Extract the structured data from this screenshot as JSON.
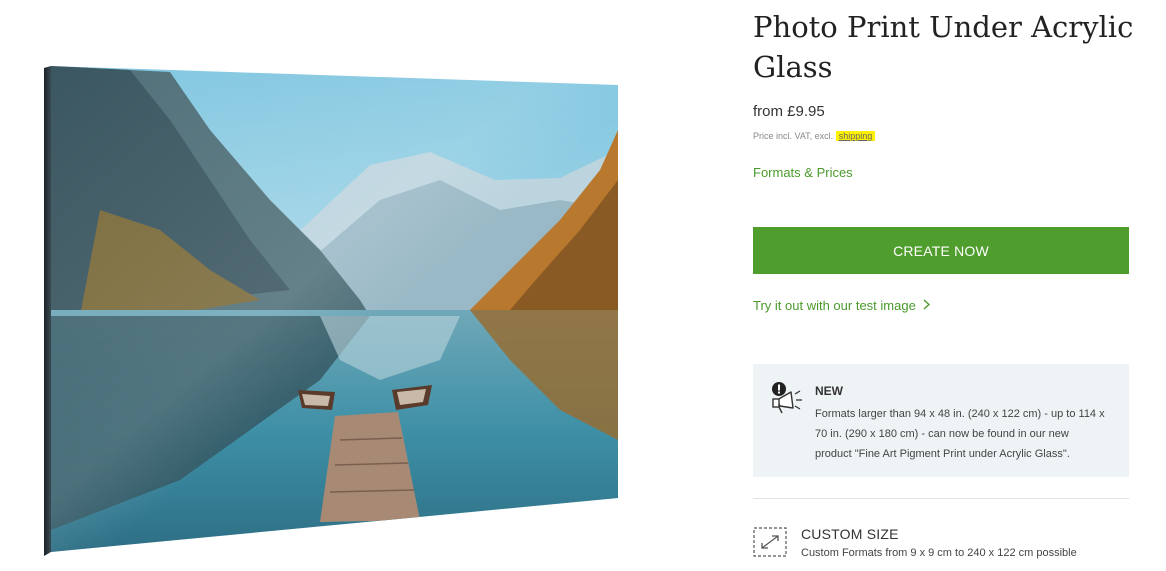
{
  "product": {
    "title": "Photo Print Under Acrylic Glass",
    "price": "from £9.95",
    "vat_prefix": "Price incl. VAT, excl.",
    "vat_link": "shipping"
  },
  "links": {
    "formats": "Formats & Prices",
    "test_image": "Try it out with our test image"
  },
  "cta": {
    "label": "CREATE NOW"
  },
  "notice": {
    "title": "NEW",
    "text": "Formats larger than 94 x 48 in. (240 x 122 cm) - up to 114 x 70 in. (290 x 180 cm) - can now be found in our new product \"Fine Art Pigment Print under Acrylic Glass\"."
  },
  "custom_size": {
    "title": "CUSTOM SIZE",
    "text": "Custom Formats from 9 x 9 cm to 240 x 122 cm possible"
  },
  "icons": {
    "notice": "announcement-megaphone-icon",
    "custom": "resize-expand-icon",
    "chevron": "chevron-right-icon"
  },
  "colors": {
    "accent": "#4f9d2d",
    "link": "#4a9a2c",
    "highlight": "#fff200",
    "notice_bg": "#eef3f6"
  }
}
